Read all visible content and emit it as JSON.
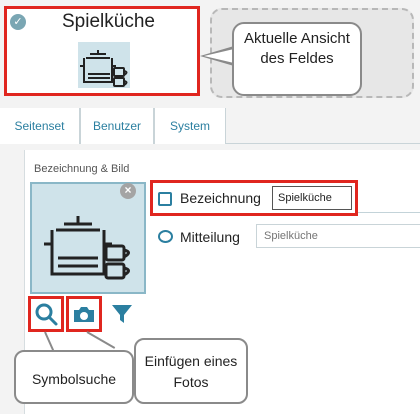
{
  "field_tile": {
    "title": "Spielküche",
    "check_icon": "check-circle-icon",
    "image_icon": "cooking-pot-plates-cups-icon"
  },
  "callouts": {
    "current_view": "Aktuelle Ansicht des Feldes",
    "symbol_search": "Symbolsuche",
    "insert_photo": "Einfügen eines Fotos"
  },
  "tabs": [
    {
      "label": "Seitenset"
    },
    {
      "label": "Benutzer"
    },
    {
      "label": "System"
    }
  ],
  "form": {
    "section_label": "Bezeichnung & Bild",
    "name_label": "Bezeichnung",
    "name_value": "Spielküche",
    "message_label": "Mitteilung",
    "message_placeholder": "Spielküche",
    "name_icon": "text-field-icon",
    "message_icon": "speech-bubble-icon"
  },
  "actions": {
    "search_icon": "search-icon",
    "camera_icon": "camera-icon",
    "filter_icon": "filter-icon",
    "close_icon": "close-icon"
  },
  "colors": {
    "accent": "#2b7fa0",
    "highlight_border": "#e0261f",
    "image_bg": "#cfe3ea"
  }
}
